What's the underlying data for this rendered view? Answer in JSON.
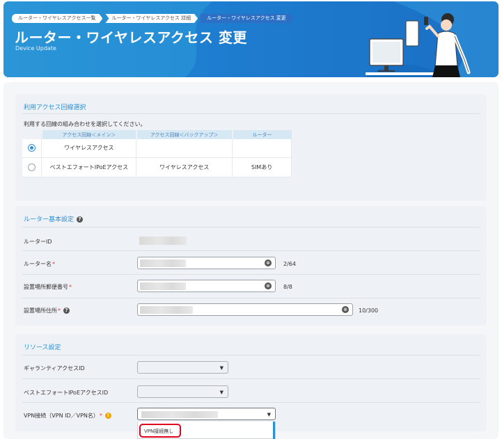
{
  "header": {
    "breadcrumbs": [
      "ルーター・ワイヤレスアクセス一覧",
      "ルーター・ワイヤレスアクセス 詳細",
      "ルーター・ワイヤレスアクセス 変更"
    ],
    "title": "ルーター・ワイヤレスアクセス 変更",
    "subtitle": "Device Update"
  },
  "line_selection": {
    "title": "利用アクセス回線選択",
    "instruction": "利用する回線の組み合わせを選択してください。",
    "columns": [
      "アクセス回線＜メイン＞",
      "アクセス回線＜バックアップ＞",
      "ルーター"
    ],
    "rows": [
      {
        "main": "ワイヤレスアクセス",
        "backup": "",
        "router": "",
        "selected": true
      },
      {
        "main": "ベストエフォートIPoEアクセス",
        "backup": "ワイヤレスアクセス",
        "router": "SIMあり",
        "selected": false
      }
    ]
  },
  "router_settings": {
    "title": "ルーター基本設定",
    "router_id_label": "ルーターID",
    "router_name_label": "ルーター名",
    "router_name_count": "2/64",
    "postal_label": "設置場所郵便番号",
    "postal_count": "8/8",
    "address_label": "設置場所住所",
    "address_count": "10/300",
    "required_mark": "*",
    "clear_icon": "⊗"
  },
  "resource_settings": {
    "title": "リソース設定",
    "guaranty_label": "ギャランティアクセスID",
    "besteffort_label": "ベストエフォートIPoEアクセスID",
    "vpn_label": "VPN接続（VPN ID／VPN名）",
    "caret": "▼",
    "dropdown_option": "VPN接続無し"
  },
  "colors": {
    "accent": "#2e8fd6",
    "banner": "#1f7fd1",
    "required": "#e53935",
    "highlight": "#e0001b",
    "warning": "#f0a400"
  }
}
